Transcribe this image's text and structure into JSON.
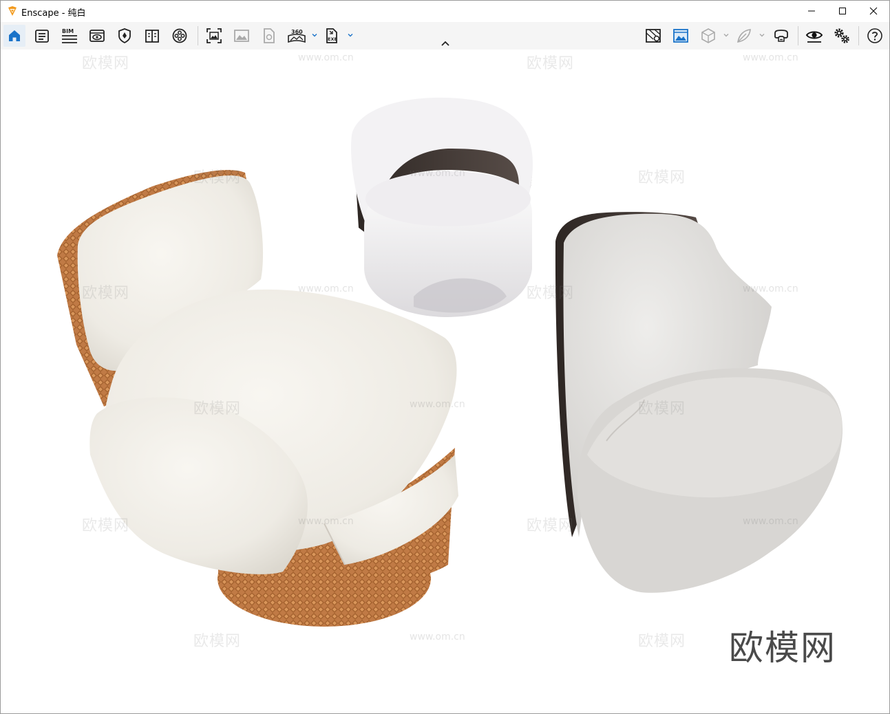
{
  "window": {
    "app_name": "Enscape",
    "title": "Enscape - 纯白"
  },
  "toolbar": {
    "left_icons": [
      "home-icon",
      "document-list-icon",
      "bim-icon",
      "view-eye-icon",
      "shield-icon",
      "book-icon",
      "film-reel-icon",
      "screenshot-icon",
      "image-icon",
      "file-render-icon",
      "panorama-360-icon",
      "exe-export-icon"
    ],
    "right_icons": [
      "map-icon",
      "landscape-view-icon",
      "cube-icon",
      "leaf-icon",
      "vr-headset-icon",
      "eye-icon",
      "settings-gears-icon",
      "help-icon"
    ],
    "bim_label": "BIM",
    "pano_label": "360",
    "exe_label": "EXE",
    "accent": "#1a73c9"
  },
  "viewport": {
    "watermark_text": "欧模网",
    "watermark_url": "www.om.cn",
    "brand_watermark": "欧模网"
  }
}
